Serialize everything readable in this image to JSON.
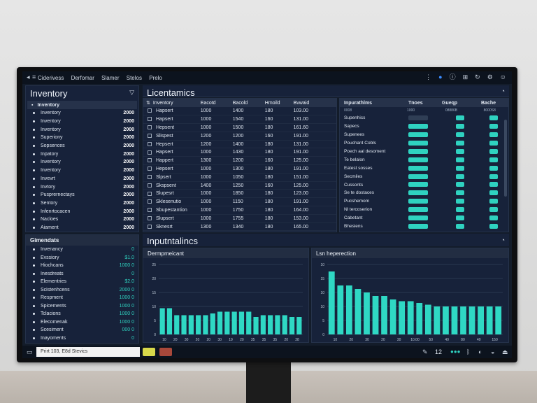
{
  "topbar": {
    "menu": [
      "Ciderivess",
      "Derfomar",
      "Slamer",
      "Stelos",
      "Prelo"
    ]
  },
  "left_panel": {
    "title": "Inventory",
    "header": "Inventory",
    "items": [
      {
        "label": "Inventory",
        "value": "2000"
      },
      {
        "label": "Inventory",
        "value": "2000"
      },
      {
        "label": "Inventory",
        "value": "2000"
      },
      {
        "label": "Superiony",
        "value": "2000"
      },
      {
        "label": "Sopsences",
        "value": "2000"
      },
      {
        "label": "Inpatory",
        "value": "2000"
      },
      {
        "label": "Inventory",
        "value": "2000"
      },
      {
        "label": "Inventory",
        "value": "2000"
      },
      {
        "label": "Invevrt",
        "value": "2000"
      },
      {
        "label": "Invtory",
        "value": "2000"
      },
      {
        "label": "Pusprernectays",
        "value": "2000"
      },
      {
        "label": "Sentory",
        "value": "2000"
      },
      {
        "label": "Infenrtocacen",
        "value": "2000"
      },
      {
        "label": "Nacloes",
        "value": "2000"
      },
      {
        "label": "Aiament",
        "value": "2000"
      }
    ]
  },
  "left_bottom": {
    "title": "Gimendats",
    "items": [
      {
        "label": "Invenancy",
        "value": "0"
      },
      {
        "label": "Evssiory",
        "value": "$1.0"
      },
      {
        "label": "Hiochcans",
        "value": "1000 0"
      },
      {
        "label": "Inesdreats",
        "value": "0"
      },
      {
        "label": "Elementries",
        "value": "$2.0"
      },
      {
        "label": "Scistenhcens",
        "value": "2000 0"
      },
      {
        "label": "Respment",
        "value": "1000 0"
      },
      {
        "label": "Spicements",
        "value": "1000 0"
      },
      {
        "label": "Tclacions",
        "value": "1000 0"
      },
      {
        "label": "Elecomenak",
        "value": "1000 0"
      },
      {
        "label": "Scesiment",
        "value": "000 0"
      },
      {
        "label": "Inayoments",
        "value": "0"
      }
    ]
  },
  "center": {
    "title": "Licentamics",
    "headers": [
      "Inventory",
      "Eacotd",
      "Bacold",
      "Hmoild",
      "Bvwaid"
    ],
    "rows": [
      [
        "Hapsert",
        "1000",
        "1400",
        "180",
        "103.00"
      ],
      [
        "Hapsert",
        "1000",
        "1540",
        "160",
        "131.00"
      ],
      [
        "Hepsent",
        "1000",
        "1500",
        "180",
        "161.60"
      ],
      [
        "Slispest",
        "1200",
        "1200",
        "160",
        "191.00"
      ],
      [
        "Hepsert",
        "1200",
        "1400",
        "180",
        "131.00"
      ],
      [
        "Hapsert",
        "1000",
        "1430",
        "180",
        "191.00"
      ],
      [
        "Happert",
        "1300",
        "1200",
        "160",
        "125.00"
      ],
      [
        "Hepsert",
        "1000",
        "1300",
        "180",
        "191.00"
      ],
      [
        "Slpsert",
        "1000",
        "1050",
        "180",
        "151.00"
      ],
      [
        "Skspsent",
        "1400",
        "1250",
        "160",
        "125.00"
      ],
      [
        "Slupesrt",
        "1000",
        "1850",
        "180",
        "123.00"
      ],
      [
        "Sklesenutio",
        "1000",
        "1150",
        "180",
        "191.00"
      ],
      [
        "Sbupestantion",
        "1000",
        "1750",
        "180",
        "164.00"
      ],
      [
        "Slupsert",
        "1000",
        "1755",
        "180",
        "153.00"
      ],
      [
        "Sknesrt",
        "1300",
        "1340",
        "180",
        "165.00"
      ]
    ]
  },
  "right_panel": {
    "headers": [
      "Inpurathlms",
      "Tnoes",
      "Gueqp",
      "Bache"
    ],
    "subheaders": [
      "0008",
      "1000",
      "08886B",
      "8000S8"
    ],
    "rows": [
      {
        "label": "Supenhics",
        "a": 0.35,
        "b": 1,
        "c": 1
      },
      {
        "label": "Sapecs",
        "a": 1,
        "b": 1,
        "c": 1
      },
      {
        "label": "Supenees",
        "a": 1,
        "b": 1,
        "c": 1
      },
      {
        "label": "Pouchant Cobls",
        "a": 1,
        "b": 1,
        "c": 1
      },
      {
        "label": "Poech aal desoment",
        "a": 1,
        "b": 1,
        "c": 1
      },
      {
        "label": "Te belalon",
        "a": 1,
        "b": 1,
        "c": 1
      },
      {
        "label": "Eatest sosses",
        "a": 1,
        "b": 1,
        "c": 1
      },
      {
        "label": "Secmiles",
        "a": 1,
        "b": 1,
        "c": 1
      },
      {
        "label": "Cussonts",
        "a": 1,
        "b": 1,
        "c": 1
      },
      {
        "label": "Se te dostaces",
        "a": 1,
        "b": 1,
        "c": 1
      },
      {
        "label": "Pucshemom",
        "a": 1,
        "b": 1,
        "c": 1
      },
      {
        "label": "Nl tercoserion",
        "a": 1,
        "b": 1,
        "c": 1
      },
      {
        "label": "Cabetant",
        "a": 1,
        "b": 1,
        "c": 1
      },
      {
        "label": "Bhesiens",
        "a": 1,
        "b": 1,
        "c": 1
      }
    ]
  },
  "analytics": {
    "title": "Inputntalincs"
  },
  "chart_data": [
    {
      "type": "bar",
      "title": "Dermpmeicant",
      "ylim": [
        0,
        20
      ],
      "yticks": [
        "25",
        "20",
        "15",
        "10",
        "5",
        "0"
      ],
      "categories": [
        "10",
        "20",
        "30",
        "20",
        "20",
        "30",
        "19",
        "20",
        "35",
        "35",
        "35",
        "20",
        "28"
      ],
      "values": [
        7.5,
        7.5,
        5.5,
        5.5,
        5.5,
        5.5,
        5.5,
        6,
        6.5,
        6.5,
        6.5,
        6.5,
        6.5,
        5,
        5.5,
        5.5,
        5.5,
        5.5,
        5,
        5
      ]
    },
    {
      "type": "bar",
      "title": "Lsn heperection",
      "ylim": [
        0,
        20
      ],
      "yticks": [
        "10",
        "15",
        "10",
        "10",
        "5",
        "0"
      ],
      "categories": [
        "10",
        "20",
        "30",
        "20",
        "30",
        "10.00",
        "50",
        "40",
        "80",
        "40",
        "150"
      ],
      "values": [
        18,
        14,
        14,
        13,
        12,
        11,
        11,
        10,
        9.5,
        9.5,
        9,
        8.5,
        8,
        8,
        8,
        8,
        8,
        8,
        8,
        8
      ]
    }
  ],
  "status": {
    "search": "Prirt 103, E8d Stevics",
    "num": "12"
  }
}
